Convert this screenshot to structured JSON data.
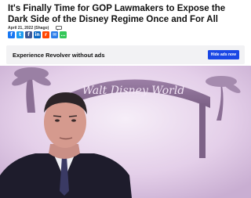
{
  "article": {
    "headline": "It's Finally Time for GOP Lawmakers to Expose the Dark Side of the Disney Regime Once and For All",
    "date": "April 21, 2022 (Shago)"
  },
  "share_buttons": [
    {
      "icon": "facebook-icon",
      "glyph": "f",
      "color": "#1877f2"
    },
    {
      "icon": "twitter-icon",
      "glyph": "t",
      "color": "#1d9bf0"
    },
    {
      "icon": "facebook-icon",
      "glyph": "f",
      "color": "#3b5998"
    },
    {
      "icon": "linkedin-icon",
      "glyph": "in",
      "color": "#0a66c2"
    },
    {
      "icon": "reddit-icon",
      "glyph": "r",
      "color": "#ff4500"
    },
    {
      "icon": "email-icon",
      "glyph": "✉",
      "color": "#2b7de9"
    },
    {
      "icon": "sms-icon",
      "glyph": "…",
      "color": "#34c759"
    }
  ],
  "ad": {
    "text": "Experience Revolver without ads",
    "button_label": "Hide ads now",
    "button_color": "#1a47e5"
  },
  "photo": {
    "sign_text": "Walt Disney World",
    "tint": "#ead7f0"
  }
}
